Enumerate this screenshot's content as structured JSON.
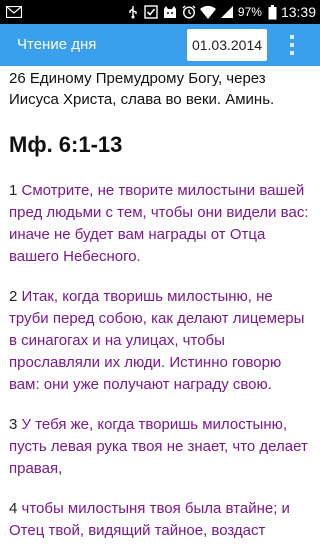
{
  "status_bar": {
    "icons_left": [
      "gmail-icon"
    ],
    "icons_right": [
      "usb-icon",
      "checkbox-icon",
      "cat-icon",
      "alarm-clock-icon",
      "wifi-icon",
      "signal-icon",
      "battery-icon"
    ],
    "battery": "97%",
    "time": "13:39"
  },
  "action_bar": {
    "title": "Чтение дня",
    "date": "01.03.2014",
    "color": "#3aa0ee"
  },
  "content": {
    "intro": "26 Единому Премудрому Богу, через Иисуса Христа, слава во веки. Аминь.",
    "heading": "Мф. 6:1-13",
    "verses": [
      {
        "num": "1",
        "text": "Смотрите, не творите милостыни вашей пред людьми с тем, чтобы они видели вас: иначе не будет вам награды от Отца вашего Небесного."
      },
      {
        "num": "2",
        "text": "Итак, когда творишь милостыню, не труби перед собою, как делают лицемеры в синагогах и на улицах, чтобы прославляли их люди. Истинно говорю вам: они уже получают награду свою."
      },
      {
        "num": "3",
        "text": "У тебя же, когда творишь милостыню, пусть левая рука твоя не знает, что делает правая,"
      },
      {
        "num": "4",
        "text": "чтобы милостыня твоя была втайне; и Отец твой, видящий тайное, воздаст"
      }
    ],
    "verse_color": "#7a1a8c"
  }
}
